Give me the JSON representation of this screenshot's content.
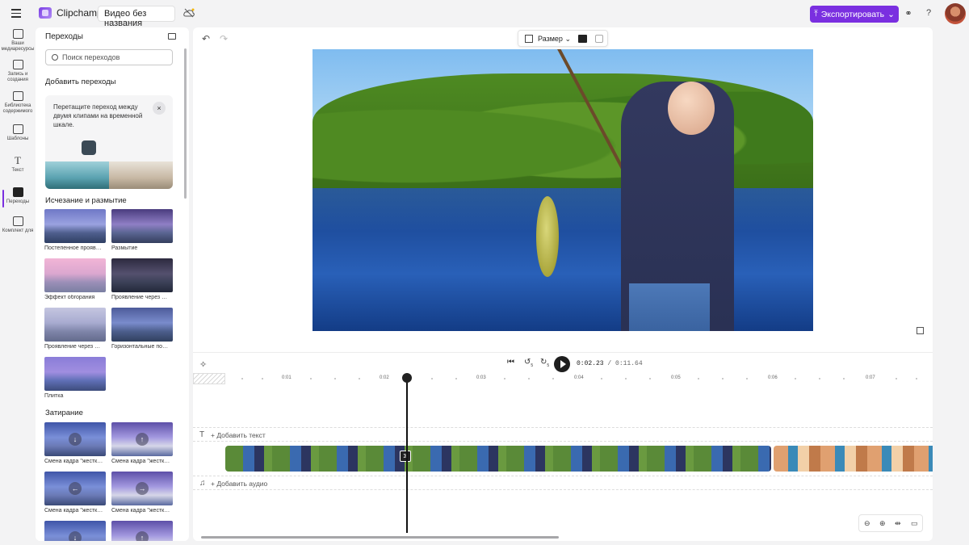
{
  "app": {
    "name": "Clipchamp",
    "project_title": "Видео без названия",
    "export_label": "Экспортировать",
    "accent_color": "#7a2fe0"
  },
  "nav": [
    {
      "label": "Ваши медиаресурсы",
      "icon": "folder-icon"
    },
    {
      "label": "Запись и создания",
      "icon": "camera-icon"
    },
    {
      "label": "Библиотека содержимого",
      "icon": "library-icon"
    },
    {
      "label": "Шаблоны",
      "icon": "templates-icon"
    },
    {
      "label": "Текст",
      "icon": "text-icon"
    },
    {
      "label": "Переходы",
      "icon": "transitions-icon",
      "active": true
    },
    {
      "label": "Комплект для",
      "icon": "brand-kit-icon"
    }
  ],
  "panel": {
    "title": "Переходы",
    "search_placeholder": "Поиск переходов",
    "add_section": "Добавить переходы",
    "hint_text": "Перетащите переход между двумя клипами на временной шкале.",
    "close_glyph": "×",
    "fade_section": "Исчезание и размытие",
    "wipe_section": "Затирание",
    "fade_items": [
      "Постепенное прояв…",
      "Размытие",
      "Эффект обгорания",
      "Проявление через …",
      "Проявление через …",
      "Горизонтальные по…",
      "Плитка"
    ],
    "wipe_items": [
      "Смена кадра \"жестк…",
      "Смена кадра \"жестк…",
      "Смена кадра \"жестк…",
      "Смена кадра \"жестк…"
    ]
  },
  "toolbar": {
    "size_label": "Размер"
  },
  "player": {
    "current_time": "0:02.23",
    "total_time": "/ 0:11.64",
    "skip_back": "5",
    "skip_fwd": "5"
  },
  "ruler": [
    "0:01",
    "0:02",
    "0:03",
    "0:04",
    "0:05",
    "0:06",
    "0:07"
  ],
  "tracks": {
    "add_text": "+ Добавить текст",
    "add_audio": "+ Добавить аудио"
  }
}
